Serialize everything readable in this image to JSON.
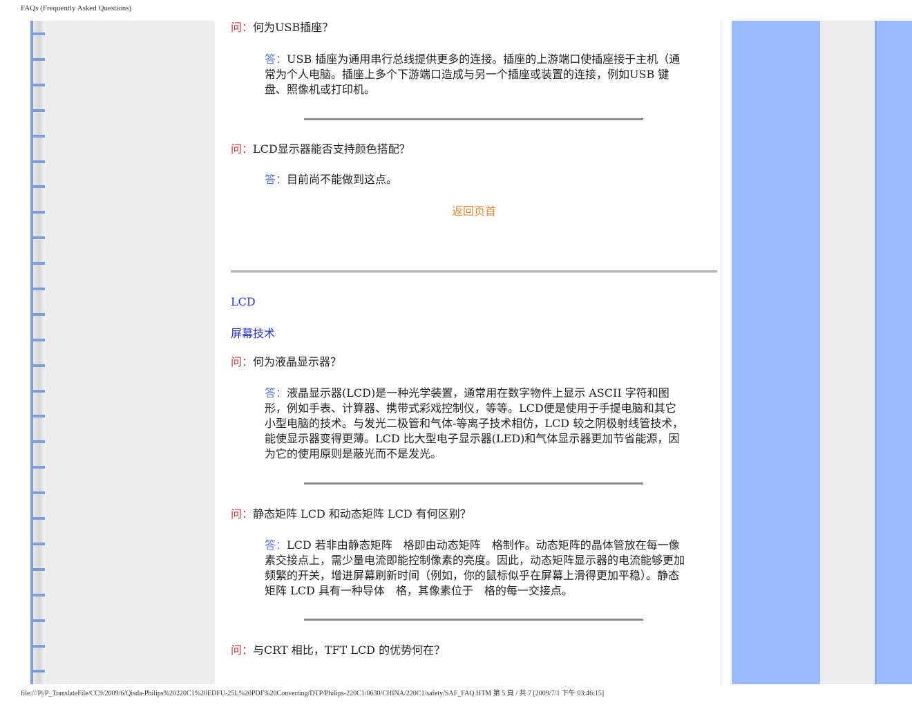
{
  "header": {
    "title": "FAQs (Frequently Asked Questions)"
  },
  "footer": {
    "path": "file:///P|/P_TranslateFile/CC9/2009/6/Qisda-Philips%20220C1%20EDFU-25L%20PDF%20Converting/DTP/Philips-220C1/0630/CHINA/220C1/safety/SAF_FAQ.HTM 第 5 頁 / 共 7  [2009/7/1 下午 03:46:15]"
  },
  "labels": {
    "question": "问：",
    "answer": "答："
  },
  "faq1": {
    "question": "何为USB插座？",
    "answer": "USB 插座为通用串行总线提供更多的连接。插座的上游端口使插座接于主机（通常为个人电脑。插座上多个下游端口造成与另一个插座或装置的连接，例如USB 键盘、照像机或打印机。"
  },
  "faq2": {
    "question": "LCD显示器能否支持颜色搭配？",
    "answer": "目前尚不能做到这点。"
  },
  "back_to_top": "返回页首",
  "section": {
    "line1": "LCD",
    "line2": "屏幕技术"
  },
  "faq3": {
    "question": "何为液晶显示器？",
    "answer": "液晶显示器(LCD)是一种光学装置，通常用在数字物件上显示 ASCII 字符和图形，例如手表、计算器、携带式彩戏控制仪，等等。LCD便是使用于手提电脑和其它小型电脑的技术。与发光二极管和气体-等离子技术相仿，LCD 较之阴极射线管技术，能使显示器变得更薄。LCD 比大型电子显示器(LED)和气体显示器更加节省能源，因为它的使用原则是蔽光而不是发光。"
  },
  "faq4": {
    "question": "静态矩阵 LCD 和动态矩阵 LCD 有何区别？",
    "answer": "LCD 若非由静态矩阵　格即由动态矩阵　格制作。动态矩阵的晶体管放在每一像素交接点上，需少量电流即能控制像素的亮度。因此，动态矩阵显示器的电流能够更加频繁的开关，增进屏幕刷新时间（例如，你的鼠标似乎在屏幕上滑得更加平稳）。静态矩阵 LCD 具有一种导体　格，其像素位于　格的每一交接点。"
  },
  "faq5": {
    "question": "与CRT 相比，TFT LCD 的优势何在？"
  }
}
